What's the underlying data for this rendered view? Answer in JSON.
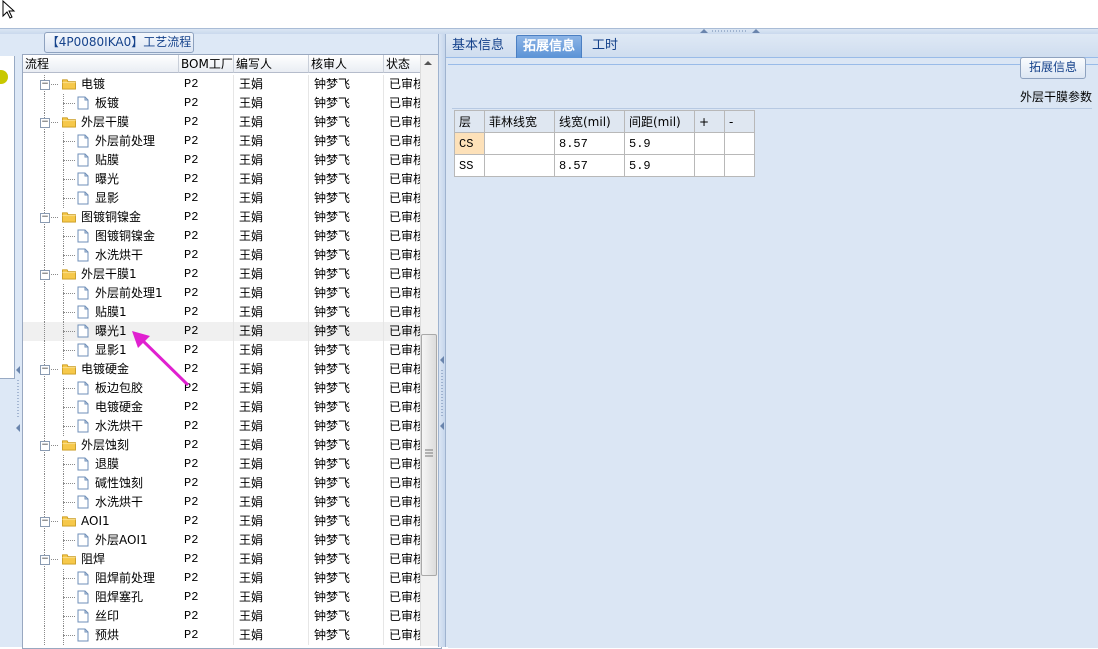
{
  "tree": {
    "panel_title": "【4P0080IKA0】工艺流程",
    "columns": [
      "流程",
      "BOM工厂",
      "编写人",
      "核审人",
      "状态"
    ],
    "rows": [
      {
        "label": "电镀",
        "type": "folder",
        "bom": "P2",
        "writer": "王娟",
        "reviewer": "钟梦飞",
        "status": "已审核"
      },
      {
        "label": "板镀",
        "type": "doc",
        "bom": "P2",
        "writer": "王娟",
        "reviewer": "钟梦飞",
        "status": "已审核"
      },
      {
        "label": "外层干膜",
        "type": "folder",
        "bom": "P2",
        "writer": "王娟",
        "reviewer": "钟梦飞",
        "status": "已审核"
      },
      {
        "label": "外层前处理",
        "type": "doc",
        "bom": "P2",
        "writer": "王娟",
        "reviewer": "钟梦飞",
        "status": "已审核"
      },
      {
        "label": "贴膜",
        "type": "doc",
        "bom": "P2",
        "writer": "王娟",
        "reviewer": "钟梦飞",
        "status": "已审核"
      },
      {
        "label": "曝光",
        "type": "doc",
        "bom": "P2",
        "writer": "王娟",
        "reviewer": "钟梦飞",
        "status": "已审核"
      },
      {
        "label": "显影",
        "type": "doc",
        "bom": "P2",
        "writer": "王娟",
        "reviewer": "钟梦飞",
        "status": "已审核"
      },
      {
        "label": "图镀铜镍金",
        "type": "folder",
        "bom": "P2",
        "writer": "王娟",
        "reviewer": "钟梦飞",
        "status": "已审核"
      },
      {
        "label": "图镀铜镍金",
        "type": "doc",
        "bom": "P2",
        "writer": "王娟",
        "reviewer": "钟梦飞",
        "status": "已审核"
      },
      {
        "label": "水洗烘干",
        "type": "doc",
        "bom": "P2",
        "writer": "王娟",
        "reviewer": "钟梦飞",
        "status": "已审核"
      },
      {
        "label": "外层干膜1",
        "type": "folder",
        "bom": "P2",
        "writer": "王娟",
        "reviewer": "钟梦飞",
        "status": "已审核"
      },
      {
        "label": "外层前处理1",
        "type": "doc",
        "bom": "P2",
        "writer": "王娟",
        "reviewer": "钟梦飞",
        "status": "已审核"
      },
      {
        "label": "贴膜1",
        "type": "doc",
        "bom": "P2",
        "writer": "王娟",
        "reviewer": "钟梦飞",
        "status": "已审核"
      },
      {
        "label": "曝光1",
        "type": "doc",
        "bom": "P2",
        "writer": "王娟",
        "reviewer": "钟梦飞",
        "status": "已审核",
        "selected": true
      },
      {
        "label": "显影1",
        "type": "doc",
        "bom": "P2",
        "writer": "王娟",
        "reviewer": "钟梦飞",
        "status": "已审核"
      },
      {
        "label": "电镀硬金",
        "type": "folder",
        "bom": "P2",
        "writer": "王娟",
        "reviewer": "钟梦飞",
        "status": "已审核"
      },
      {
        "label": "板边包胶",
        "type": "doc",
        "bom": "P2",
        "writer": "王娟",
        "reviewer": "钟梦飞",
        "status": "已审核"
      },
      {
        "label": "电镀硬金",
        "type": "doc",
        "bom": "P2",
        "writer": "王娟",
        "reviewer": "钟梦飞",
        "status": "已审核"
      },
      {
        "label": "水洗烘干",
        "type": "doc",
        "bom": "P2",
        "writer": "王娟",
        "reviewer": "钟梦飞",
        "status": "已审核"
      },
      {
        "label": "外层蚀刻",
        "type": "folder",
        "bom": "P2",
        "writer": "王娟",
        "reviewer": "钟梦飞",
        "status": "已审核"
      },
      {
        "label": "退膜",
        "type": "doc",
        "bom": "P2",
        "writer": "王娟",
        "reviewer": "钟梦飞",
        "status": "已审核"
      },
      {
        "label": "碱性蚀刻",
        "type": "doc",
        "bom": "P2",
        "writer": "王娟",
        "reviewer": "钟梦飞",
        "status": "已审核"
      },
      {
        "label": "水洗烘干",
        "type": "doc",
        "bom": "P2",
        "writer": "王娟",
        "reviewer": "钟梦飞",
        "status": "已审核"
      },
      {
        "label": "AOI1",
        "type": "folder",
        "bom": "P2",
        "writer": "王娟",
        "reviewer": "钟梦飞",
        "status": "已审核"
      },
      {
        "label": "外层AOI1",
        "type": "doc",
        "bom": "P2",
        "writer": "王娟",
        "reviewer": "钟梦飞",
        "status": "已审核"
      },
      {
        "label": "阻焊",
        "type": "folder",
        "bom": "P2",
        "writer": "王娟",
        "reviewer": "钟梦飞",
        "status": "已审核"
      },
      {
        "label": "阻焊前处理",
        "type": "doc",
        "bom": "P2",
        "writer": "王娟",
        "reviewer": "钟梦飞",
        "status": "已审核"
      },
      {
        "label": "阻焊塞孔",
        "type": "doc",
        "bom": "P2",
        "writer": "王娟",
        "reviewer": "钟梦飞",
        "status": "已审核"
      },
      {
        "label": "丝印",
        "type": "doc",
        "bom": "P2",
        "writer": "王娟",
        "reviewer": "钟梦飞",
        "status": "已审核"
      },
      {
        "label": "预烘",
        "type": "doc",
        "bom": "P2",
        "writer": "王娟",
        "reviewer": "钟梦飞",
        "status": "已审核"
      }
    ]
  },
  "tabs": [
    "基本信息",
    "拓展信息",
    "工时"
  ],
  "active_tab": "拓展信息",
  "ext_button": "拓展信息",
  "params": {
    "title": "外层干膜参数",
    "headers": [
      "层",
      "菲林线宽",
      "线宽(mil)",
      "间距(mil)",
      "+",
      "-"
    ],
    "rows": [
      {
        "layer": "CS",
        "film": "",
        "width": "8.57",
        "spacing": "5.9",
        "plus": "",
        "minus": ""
      },
      {
        "layer": "SS",
        "film": "",
        "width": "8.57",
        "spacing": "5.9",
        "plus": "",
        "minus": ""
      }
    ]
  },
  "colors": {
    "accent": "#e020d0",
    "tab_active": "#5b93d6",
    "panel_bg": "#dbe6f4",
    "layer_cell": "#fde1b9"
  }
}
